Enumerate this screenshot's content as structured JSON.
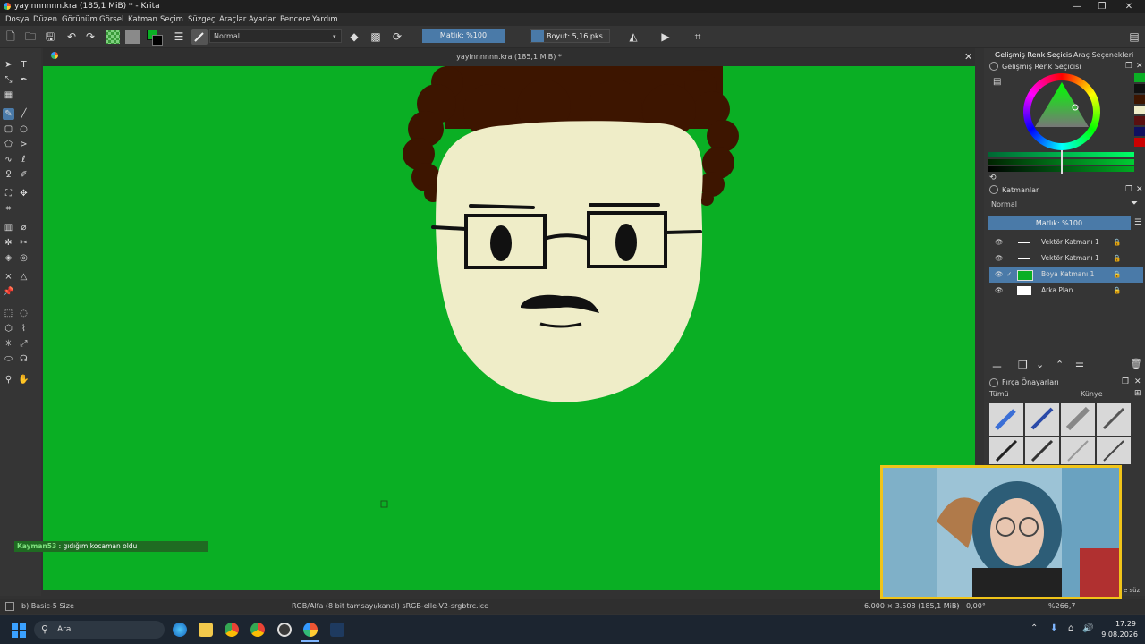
{
  "window": {
    "title": "yayinnnnnn.kra (185,1 MiB) * - Krita",
    "minimize": "—",
    "maximize": "❐",
    "close": "✕"
  },
  "menubar": [
    "Dosya",
    "Düzen",
    "Görünüm",
    "Görsel",
    "Katman",
    "Seçim",
    "Süzgeç",
    "Araçlar",
    "Ayarlar",
    "Pencere",
    "Yardım"
  ],
  "toolbar": {
    "blend_mode": "Normal",
    "opacity": "Matlık: %100",
    "size": "Boyut: 5,16 pks"
  },
  "canvas": {
    "doc_title": "yayinnnnnn.kra (185,1 MiB) *",
    "close": "✕"
  },
  "docker": {
    "tab_color": "Gelişmiş Renk Seçicisi",
    "tab_tool": "Araç Seçenekleri",
    "color_panel_title": "Gelişmiş Renk Seçicisi",
    "layers_title": "Katmanlar",
    "layers_blend": "Normal",
    "layers_opacity": "Matlık: %100",
    "layers": [
      {
        "name": "Vektör Katmanı 1",
        "selected": false
      },
      {
        "name": "Vektör Katmanı 1",
        "selected": false
      },
      {
        "name": "Boya Katmanı 1",
        "selected": true
      },
      {
        "name": "Arka Plan",
        "selected": false
      }
    ],
    "brush_title": "Fırça Önayarları",
    "brush_filter": "Tümü",
    "brush_tag": "Künye",
    "brush_search_suffix": "e süz"
  },
  "chat": {
    "user": "Kayman53",
    "message": " : gıdığım kocaman oldu"
  },
  "statusbar": {
    "brush": "b) Basic-5 Size",
    "color_space": "RGB/Alfa (8 bit tamsayı/kanal)  sRGB-elle-V2-srgbtrc.icc",
    "dimensions": "6.000 × 3.508 (185,1 MiB)",
    "rotation": "0,00°",
    "zoom": "%266,7"
  },
  "taskbar": {
    "search": "Ara",
    "time": "17:29",
    "date": "9.08.2026"
  },
  "colors": {
    "canvas_green": "#0aaf24",
    "hair": "#3d1500",
    "skin": "#efedc8",
    "accent_blue": "#4a7aa8",
    "webcam_border": "#f0c419"
  }
}
